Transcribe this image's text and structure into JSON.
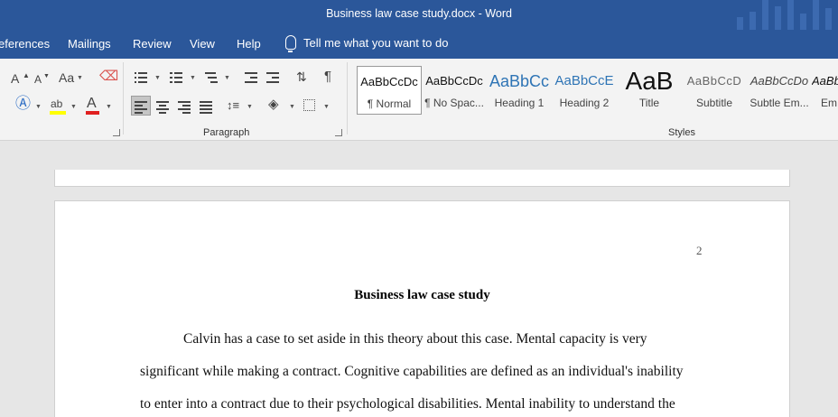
{
  "window": {
    "title": "Business law case study.docx  -  Word"
  },
  "tabs": {
    "references": "eferences",
    "mailings": "Mailings",
    "review": "Review",
    "view": "View",
    "help": "Help",
    "tell_me": "Tell me what you want to do"
  },
  "ribbon": {
    "font_group": {
      "aa_label": "Aa",
      "grow": "A",
      "shrink": "A"
    },
    "paragraph_group": {
      "label": "Paragraph"
    },
    "styles_group": {
      "label": "Styles",
      "items": [
        {
          "preview": "AaBbCcDc",
          "name": "¶ Normal"
        },
        {
          "preview": "AaBbCcDc",
          "name": "¶ No Spac..."
        },
        {
          "preview": "AaBbCc",
          "name": "Heading 1"
        },
        {
          "preview": "AaBbCcE",
          "name": "Heading 2"
        },
        {
          "preview": "AaB",
          "name": "Title"
        },
        {
          "preview": "AaBbCcD",
          "name": "Subtitle"
        },
        {
          "preview": "AaBbCcDo",
          "name": "Subtle Em..."
        },
        {
          "preview": "AaBb",
          "name": "Em"
        }
      ]
    }
  },
  "document": {
    "page_number": "2",
    "title": "Business law case study",
    "lines": [
      "Calvin has a case to set aside in this theory about this case. Mental capacity is very",
      "significant while making a contract. Cognitive capabilities are defined as an individual's inability",
      "to enter into a contract due to their psychological disabilities. Mental inability to understand the"
    ]
  },
  "colors": {
    "accent": "#2b579a",
    "ribbon": "#f3f3f3",
    "canvas": "#e6e6e6"
  }
}
